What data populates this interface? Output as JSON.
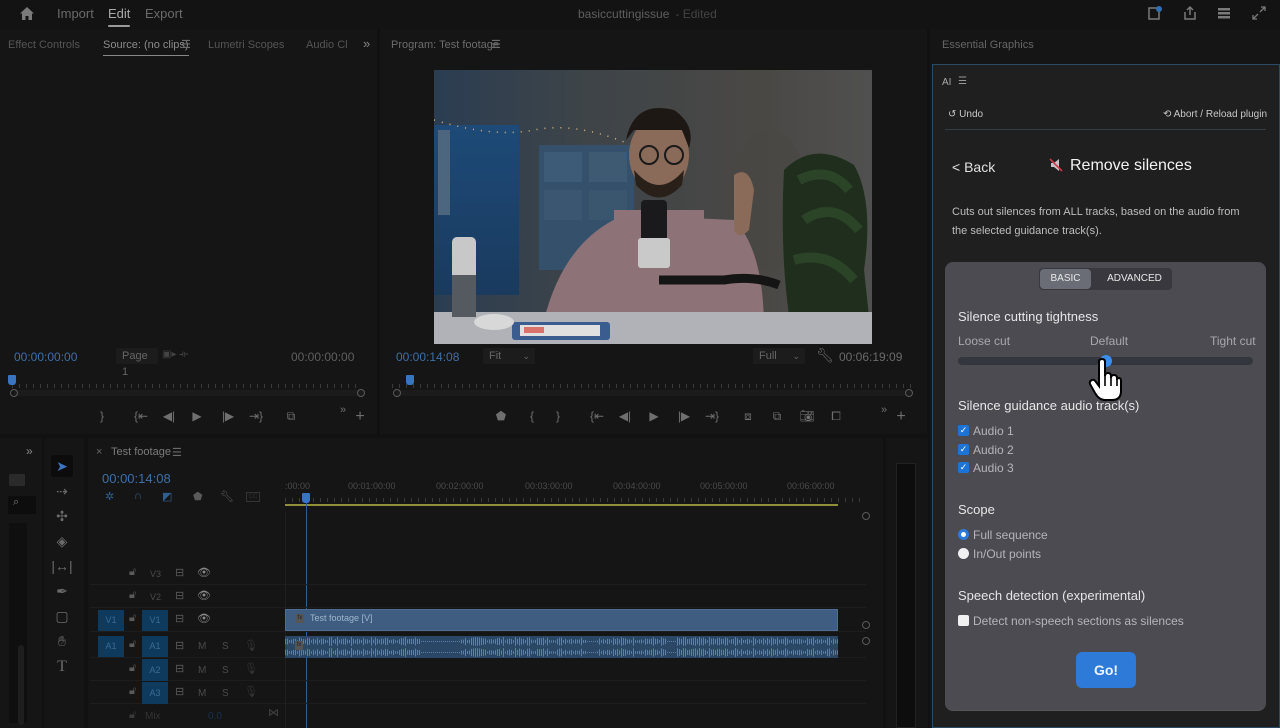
{
  "topbar": {
    "nav": [
      "Import",
      "Edit",
      "Export"
    ],
    "active_nav": "Edit",
    "document_title": "basiccuttingissue",
    "document_status": "- Edited",
    "icons": [
      "home-icon",
      "quick-export-icon",
      "share-icon",
      "workspaces-icon",
      "fullscreen-icon"
    ]
  },
  "source_panel": {
    "tabs": [
      "Effect Controls",
      "Source: (no clips)",
      "Lumetri Scopes",
      "Audio Cl"
    ],
    "active_tab": "Source: (no clips)",
    "overflow": "»",
    "timecode_in": "00:00:00:00",
    "page_label": "Page 1",
    "timecode_out": "00:00:00:00"
  },
  "program_panel": {
    "title": "Program: Test footage",
    "timecode": "00:00:14:08",
    "fit_option": "Fit",
    "quality_option": "Full",
    "duration": "00:06:19:09",
    "playhead_fraction": 0.038
  },
  "essential_graphics": {
    "title": "Essential Graphics"
  },
  "plugin": {
    "name": "AI",
    "undo_label": "Undo",
    "abort_label": "Abort / Reload plugin",
    "back_label": "< Back",
    "title": "Remove silences",
    "description": "Cuts out silences from ALL tracks, based on the audio from the selected guidance track(s).",
    "mode_tabs": [
      "BASIC",
      "ADVANCED"
    ],
    "active_mode": "BASIC",
    "tightness": {
      "heading": "Silence cutting tightness",
      "labels": [
        "Loose cut",
        "Default",
        "Tight cut"
      ],
      "value_fraction": 0.5
    },
    "guidance": {
      "heading": "Silence guidance audio track(s)",
      "tracks": [
        {
          "label": "Audio 1",
          "checked": true
        },
        {
          "label": "Audio 2",
          "checked": true
        },
        {
          "label": "Audio 3",
          "checked": true
        }
      ]
    },
    "scope": {
      "heading": "Scope",
      "options": [
        {
          "label": "Full sequence",
          "selected": true
        },
        {
          "label": "In/Out points",
          "selected": false
        }
      ]
    },
    "speech": {
      "heading": "Speech detection (experimental)",
      "option_label": "Detect non-speech sections as silences",
      "checked": false
    },
    "go_label": "Go!",
    "accent_color": "#2d7ad8"
  },
  "timeline": {
    "sequence_name": "Test footage",
    "timecode": "00:00:14:08",
    "ruler_labels": [
      ":00:00",
      "00:01:00:00",
      "00:02:00:00",
      "00:03:00:00",
      "00:04:00:00",
      "00:05:00:00",
      "00:06:00:00"
    ],
    "video_tracks": [
      "V3",
      "V2",
      "V1"
    ],
    "audio_tracks": [
      "A1",
      "A2",
      "A3"
    ],
    "source_patch_video": "V1",
    "source_patch_audio": "A1",
    "mix_label": "Mix",
    "mix_value": "0.0",
    "clip_video_label": "Test footage [V]",
    "clip_fx_label": "fx",
    "track_buttons": {
      "mute": "M",
      "solo": "S"
    }
  },
  "tools": [
    "selection-tool",
    "track-select-tool",
    "ripple-edit-tool",
    "razor-tool",
    "slip-tool",
    "pen-tool",
    "rectangle-tool",
    "hand-tool",
    "type-tool"
  ]
}
